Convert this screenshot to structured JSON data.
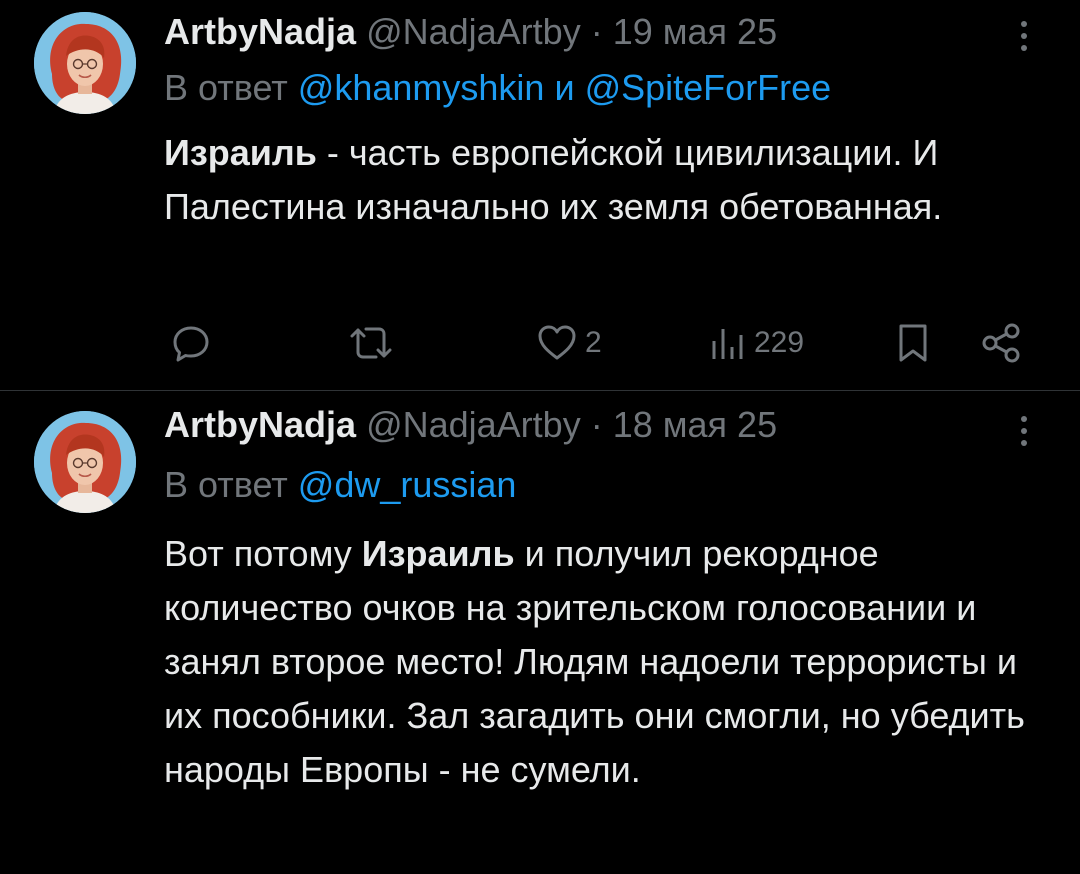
{
  "tweets": [
    {
      "display_name": "ArtbyNadja",
      "handle": "@NadjaArtby",
      "separator": "·",
      "date": "19 мая 25",
      "reply_prefix": "В ответ",
      "reply_mention_1": "@khanmyshkin",
      "reply_conjunction": "и",
      "reply_mention_2": "@SpiteForFree",
      "body_bold": "Израиль",
      "body_rest": " - часть европейской цивилизации. И Палестина изначально их земля обетованная.",
      "likes": "2",
      "views": "229"
    },
    {
      "display_name": "ArtbyNadja",
      "handle": "@NadjaArtby",
      "separator": "·",
      "date": "18 мая 25",
      "reply_prefix": "В ответ",
      "reply_mention_1": "@dw_russian",
      "body_pre": "Вот потому ",
      "body_bold": "Израиль",
      "body_rest": " и получил рекордное количество очков на зрительском голосовании и занял второе место! Людям надоели террористы и их пособники. Зал загадить они смогли, но убедить народы Европы - не сумели."
    }
  ],
  "icons": {
    "more": "more-vertical-icon",
    "reply": "comment-icon",
    "retweet": "retweet-icon",
    "like": "heart-icon",
    "views": "views-bar-chart-icon",
    "bookmark": "bookmark-icon",
    "share": "share-icon"
  },
  "colors": {
    "background": "#000000",
    "text": "#e7e9ea",
    "secondary": "#71767b",
    "link": "#1d9bf0",
    "divider": "#2f3336",
    "avatar_background": "#7ec3e6",
    "avatar_hair": "#c8412d"
  }
}
